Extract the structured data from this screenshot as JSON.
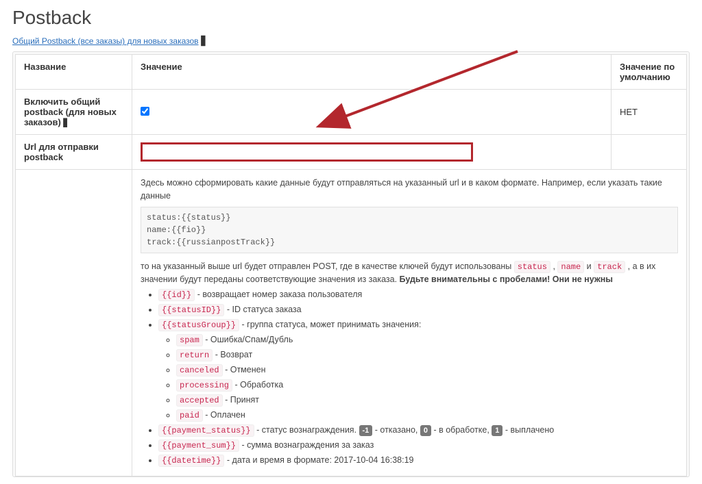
{
  "page": {
    "title": "Postback",
    "top_link": "Общий Postback (все заказы) для новых заказов"
  },
  "table": {
    "headers": {
      "name": "Название",
      "value": "Значение",
      "default": "Значение по умолчанию"
    },
    "row_enable": {
      "label": "Включить общий postback (для новых заказов)",
      "checked": true,
      "default": "НЕТ"
    },
    "row_url": {
      "label": "Url для отправки postback",
      "value": "",
      "default": ""
    }
  },
  "help": {
    "intro": "Здесь можно сформировать какие данные будут отправляться на указанный url и в каком формате. Например, если указать такие данные",
    "code_lines": [
      "status:{{status}}",
      "name:{{fio}}",
      "track:{{russianpostTrack}}"
    ],
    "after1_a": "то на указанный выше url будет отправлен POST, где в качестве ключей будут использованы ",
    "tok_status": "status",
    "comma": " , ",
    "tok_name": "name",
    "and": " и ",
    "tok_track": "track",
    "after1_b": " , а в их значении будут переданы соответствующие значения из заказа. ",
    "bold_warning": "Будьте внимательны с пробелами! Они не нужны",
    "items": [
      {
        "tok": "{{id}}",
        "desc": " - возвращает номер заказа пользователя"
      },
      {
        "tok": "{{statusID}}",
        "desc": " - ID статуса заказа"
      },
      {
        "tok": "{{statusGroup}}",
        "desc": " - группа статуса, может принимать значения:",
        "sub": [
          {
            "tok": "spam",
            "desc": " - Ошибка/Спам/Дубль"
          },
          {
            "tok": "return",
            "desc": " - Возврат"
          },
          {
            "tok": "canceled",
            "desc": " - Отменен"
          },
          {
            "tok": "processing",
            "desc": " - Обработка"
          },
          {
            "tok": "accepted",
            "desc": " - Принят"
          },
          {
            "tok": "paid",
            "desc": " - Оплачен"
          }
        ]
      }
    ],
    "payment_status_item": {
      "tok": "{{payment_status}}",
      "before": " - статус вознаграждения. ",
      "parts": [
        {
          "badge": "-1",
          "desc": " - отказано, "
        },
        {
          "badge": "0",
          "desc": " - в обработке, "
        },
        {
          "badge": "1",
          "desc": " - выплачено"
        }
      ]
    },
    "payment_sum_item": {
      "tok": "{{payment_sum}}",
      "desc": " - сумма вознаграждения за заказ"
    },
    "datetime_item": {
      "tok": "{{datetime}}",
      "desc": " - дата и время в формате: 2017-10-04 16:38:19"
    }
  }
}
